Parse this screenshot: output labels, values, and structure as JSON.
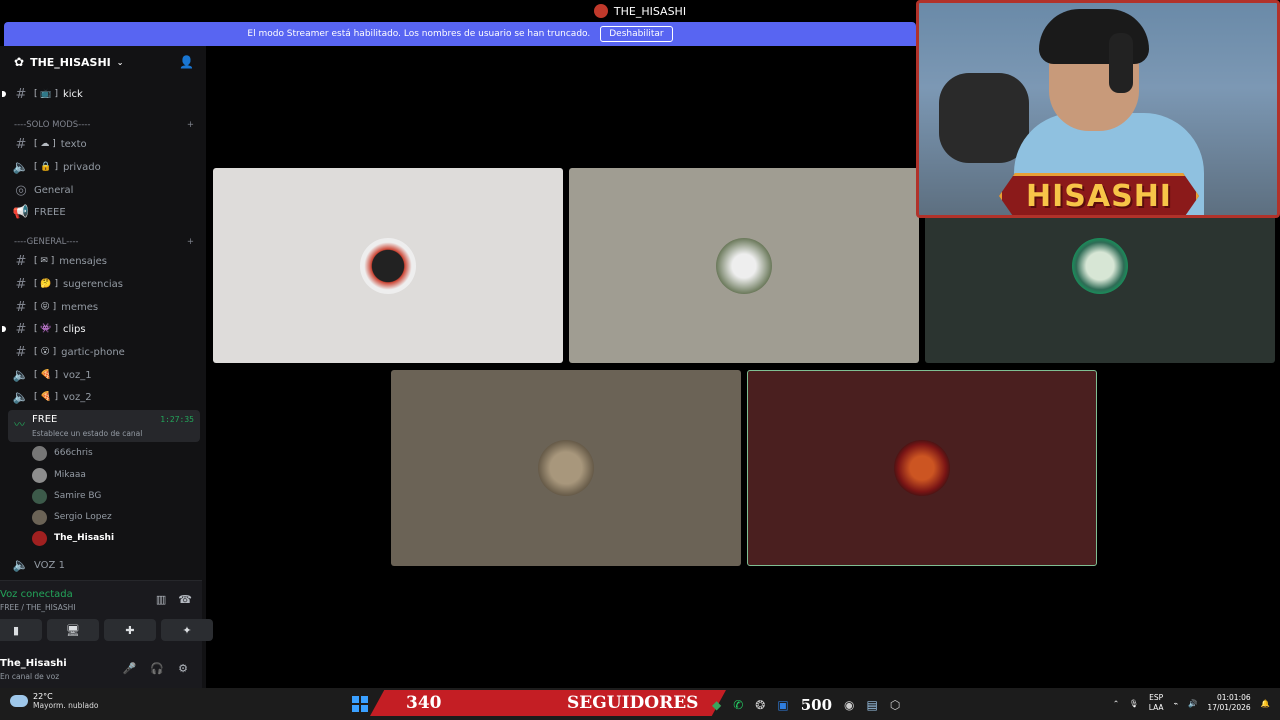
{
  "window": {
    "title": "THE_HISASHI"
  },
  "streamer_bar": {
    "message": "El modo Streamer está habilitado. Los nombres de usuario se han truncado.",
    "button": "Deshabilitar"
  },
  "server": {
    "name": "THE_HISASHI"
  },
  "categories": {
    "solo_mods": "----SOLO MODS----",
    "general": "----GENERAL----"
  },
  "channels": {
    "kick": "kick",
    "texto": "texto",
    "privado": "privado",
    "general_voice": "General",
    "freee": "FREEE",
    "mensajes": "mensajes",
    "sugerencias": "sugerencias",
    "memes": "memes",
    "clips": "clips",
    "gartic": "gartic-phone",
    "voz1": "voz_1",
    "voz2": "voz_2",
    "voz_1_upper": "VOZ 1"
  },
  "active_voice": {
    "name": "FREE",
    "status": "Establece un estado de canal",
    "time": "1:27:35"
  },
  "voice_users": [
    "666chris",
    "Mikaaa",
    "Samire BG",
    "Sergio Lopez",
    "The_Hisashi"
  ],
  "voice_panel": {
    "title": "Voz conectada",
    "sub": "FREE / THE_HISASHI"
  },
  "user_panel": {
    "name": "The_Hisashi",
    "status": "En canal de voz"
  },
  "cam_overlay": {
    "banner": "HISASHI"
  },
  "taskbar": {
    "temp": "22°C",
    "weather": "Mayorm. nublado",
    "followers_count": "340",
    "followers_label": "SEGUIDORES",
    "counter": "500",
    "lang1": "ESP",
    "lang2": "LAA",
    "time": "01:01:06",
    "date": "17/01/2026"
  },
  "colors": {
    "accent": "#5865f2",
    "connected": "#23a55a",
    "banner_red": "#c41e24"
  }
}
